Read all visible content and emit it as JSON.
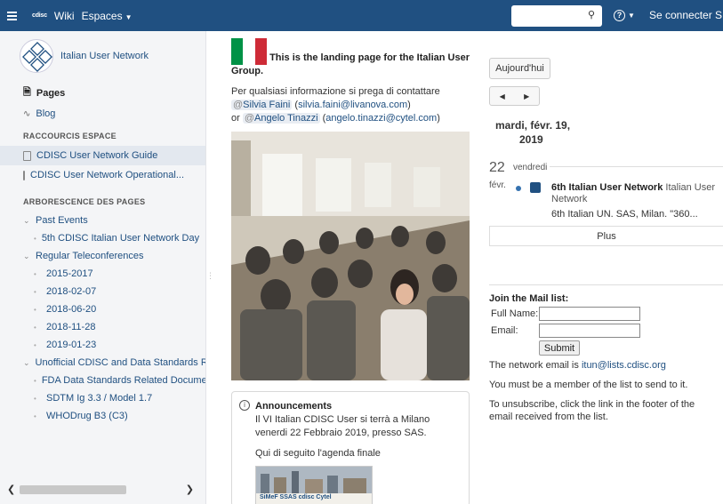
{
  "topbar": {
    "brand": "cdisc",
    "wiki": "Wiki",
    "spaces": "Espaces",
    "search_placeholder": "",
    "help": "?",
    "login": "Se connecter",
    "signup_initial": "S"
  },
  "sidebar": {
    "space_name": "Italian User Network",
    "pages": "Pages",
    "blog": "Blog",
    "shortcuts_heading": "RACCOURCIS ESPACE",
    "shortcuts": [
      "CDISC User Network Guide",
      "CDISC User Network Operational..."
    ],
    "tree_heading": "ARBORESCENCE DES PAGES",
    "tree": [
      {
        "label": "Past Events",
        "level": 0,
        "expanded": true
      },
      {
        "label": "5th CDISC Italian User Network Day",
        "level": 1
      },
      {
        "label": "Regular Teleconferences",
        "level": 0,
        "expanded": true
      },
      {
        "label": "2015-2017",
        "level": 1
      },
      {
        "label": "2018-02-07",
        "level": 1
      },
      {
        "label": "2018-06-20",
        "level": 1
      },
      {
        "label": "2018-11-28",
        "level": 1
      },
      {
        "label": "2019-01-23",
        "level": 1
      },
      {
        "label": "Unofficial CDISC and Data Standards Re",
        "level": 0,
        "expanded": true
      },
      {
        "label": "FDA Data Standards Related Docume",
        "level": 1
      },
      {
        "label": "SDTM Ig 3.3 / Model 1.7",
        "level": 1
      },
      {
        "label": "WHODrug B3 (C3)",
        "level": 1
      }
    ]
  },
  "main": {
    "intro_part1": "This is the landing page for the Italian User",
    "intro_part2": "Group.",
    "contact_line": "Per qualsiasi informazione si prega di contattare",
    "contact1_name": "Silvia Faini",
    "contact1_email": "silvia.faini@livanova.com",
    "contact2_prefix": "or",
    "contact2_name": "Angelo Tinazzi",
    "contact2_email": "angelo.tinazzi@cytel.com",
    "announce_title": "Announcements",
    "announce_text": "Il VI Italian CDISC User si terrà a Milano venerdi 22 Febbraio 2019, presso SAS.",
    "announce_text2": "Qui di seguito l'agenda finale",
    "banner_logos": "SiMeF  SSAS  cdisc  Cytel"
  },
  "calendar": {
    "today_button": "Aujourd'hui",
    "prev": "◀",
    "next": "▶",
    "date_title_line1": "mardi, févr. 19,",
    "date_title_line2": "2019",
    "day_number": "22",
    "day_name": "vendredi",
    "month": "févr.",
    "event_title": "6th Italian User Network",
    "event_calendar": "Italian User Network",
    "event_sub": "6th Italian UN. SAS, Milan. \"360...",
    "more_button": "Plus"
  },
  "mail": {
    "title": "Join the Mail list:",
    "fullname_label": "Full Name:",
    "email_label": "Email:",
    "submit": "Submit",
    "network_email_prefix": "The network email is",
    "network_email": "itun@lists.cdisc.org",
    "member_note": "You must be a member of the list to send to it.",
    "unsubscribe_note": "To unsubscribe, click the link in the footer of the email received from the list."
  },
  "colors": {
    "topbar": "#205081",
    "link": "#205081",
    "flag_green": "#009246",
    "flag_white": "#ffffff",
    "flag_red": "#ce2b37"
  }
}
